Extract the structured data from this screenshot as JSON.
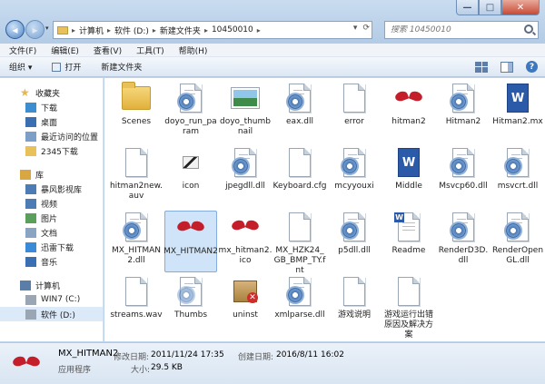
{
  "window": {
    "min": "—",
    "max": "□",
    "close": "✕"
  },
  "address": {
    "crumbs": [
      "计算机",
      "软件 (D:)",
      "新建文件夹",
      "10450010"
    ],
    "sep": "▸"
  },
  "search": {
    "placeholder": "搜索 10450010"
  },
  "menu": [
    "文件(F)",
    "编辑(E)",
    "查看(V)",
    "工具(T)",
    "帮助(H)"
  ],
  "toolbar": {
    "organize": "组织 ▾",
    "open": "打开",
    "new_folder": "新建文件夹",
    "help": "?"
  },
  "sidebar": [
    {
      "label": "收藏夹",
      "icon": "star-icon",
      "level": 0
    },
    {
      "label": "下载",
      "icon": "download-folder-icon",
      "level": 1
    },
    {
      "label": "桌面",
      "icon": "desktop-icon",
      "level": 1
    },
    {
      "label": "最近访问的位置",
      "icon": "recent-places-icon",
      "level": 1
    },
    {
      "label": "2345下载",
      "icon": "folder-icon",
      "level": 1
    },
    {
      "label": "",
      "icon": "",
      "level": -1
    },
    {
      "label": "库",
      "icon": "library-icon",
      "level": 0
    },
    {
      "label": "暴风影视库",
      "icon": "video-library-icon",
      "level": 1
    },
    {
      "label": "视频",
      "icon": "video-icon",
      "level": 1
    },
    {
      "label": "图片",
      "icon": "picture-icon",
      "level": 1
    },
    {
      "label": "文档",
      "icon": "document-icon",
      "level": 1
    },
    {
      "label": "迅雷下载",
      "icon": "thunder-download-icon",
      "level": 1
    },
    {
      "label": "音乐",
      "icon": "music-icon",
      "level": 1
    },
    {
      "label": "",
      "icon": "",
      "level": -1
    },
    {
      "label": "计算机",
      "icon": "computer-icon",
      "level": 0
    },
    {
      "label": "WIN7 (C:)",
      "icon": "drive-icon",
      "level": 1
    },
    {
      "label": "软件 (D:)",
      "icon": "drive-icon",
      "level": 1
    }
  ],
  "files": [
    {
      "name": "Scenes",
      "icon": "folder"
    },
    {
      "name": "doyo_run_param",
      "icon": "gear-doc"
    },
    {
      "name": "doyo_thumbnail",
      "icon": "image"
    },
    {
      "name": "eax.dll",
      "icon": "gear-doc"
    },
    {
      "name": "error",
      "icon": "doc"
    },
    {
      "name": "hitman2",
      "icon": "hitman"
    },
    {
      "name": "Hitman2",
      "icon": "gear-doc"
    },
    {
      "name": "Hitman2.mx",
      "icon": "word"
    },
    {
      "name": "hitman2new.auv",
      "icon": "doc"
    },
    {
      "name": "icon",
      "icon": "image-small"
    },
    {
      "name": "jpegdll.dll",
      "icon": "gear-doc"
    },
    {
      "name": "Keyboard.cfg",
      "icon": "doc"
    },
    {
      "name": "mcyyouxi",
      "icon": "gear-doc"
    },
    {
      "name": "Middle",
      "icon": "word"
    },
    {
      "name": "Msvcp60.dll",
      "icon": "gear-doc"
    },
    {
      "name": "msvcrt.dll",
      "icon": "gear-doc"
    },
    {
      "name": "MX_HITMAN2.dll",
      "icon": "gear-doc"
    },
    {
      "name": "MX_HITMAN2",
      "icon": "hitman",
      "selected": true
    },
    {
      "name": "mx_hitman2.ico",
      "icon": "hitman"
    },
    {
      "name": "MX_HZK24_GB_BMP_TY.fnt",
      "icon": "doc"
    },
    {
      "name": "p5dll.dll",
      "icon": "gear-doc"
    },
    {
      "name": "Readme",
      "icon": "word-doc"
    },
    {
      "name": "RenderD3D.dll",
      "icon": "gear-doc"
    },
    {
      "name": "RenderOpenGL.dll",
      "icon": "gear-doc"
    },
    {
      "name": "streams.wav",
      "icon": "doc"
    },
    {
      "name": "Thumbs",
      "icon": "gear-doc-light"
    },
    {
      "name": "uninst",
      "icon": "box"
    },
    {
      "name": "xmlparse.dll",
      "icon": "gear-doc"
    },
    {
      "name": "游戏说明",
      "icon": "doc"
    },
    {
      "name": "游戏运行出错原因及解决方案",
      "icon": "doc"
    }
  ],
  "status": {
    "name": "MX_HITMAN2",
    "type": "应用程序",
    "modified_label": "修改日期:",
    "modified": "2011/11/24 17:35",
    "created_label": "创建日期:",
    "created": "2016/8/11 16:02",
    "size_label": "大小:",
    "size": "29.5 KB"
  },
  "colors": {
    "accent": "#3f78bd",
    "selected_bg": "#cfe4f9",
    "hitman_red": "#c41e2a"
  }
}
